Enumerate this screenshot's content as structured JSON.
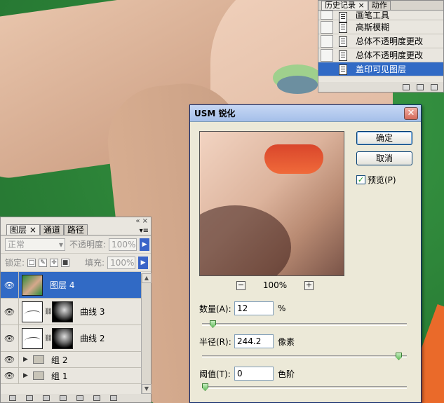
{
  "history": {
    "tabs": [
      "历史记录 ×",
      "动作"
    ],
    "items": [
      "画笔工具",
      "高斯模糊",
      "总体不透明度更改",
      "总体不透明度更改",
      "盖印可见图层"
    ],
    "selected_index": 4
  },
  "dialog": {
    "title": "USM 锐化",
    "close": "✕",
    "ok_label": "确定",
    "cancel_label": "取消",
    "preview_label": "预览(P)",
    "preview_checked": "✓",
    "zoom_out": "−",
    "zoom_in": "+",
    "zoom_value": "100%",
    "amount": {
      "label": "数量(A):",
      "value": "12",
      "unit": "%",
      "level": 0.04
    },
    "radius": {
      "label": "半径(R):",
      "value": "244.2",
      "unit": "像素",
      "level": 0.98
    },
    "threshold": {
      "label": "阈值(T):",
      "value": "0",
      "unit": "色阶",
      "level": 0.0
    }
  },
  "layers": {
    "close_glyphs": "«  ×",
    "tabs": [
      "图层 ×",
      "通道",
      "路径"
    ],
    "menu": "▾≡",
    "blend_mode": "正常",
    "opacity_label": "不透明度:",
    "opacity_value": "100%",
    "lock_label": "锁定:",
    "fill_label": "填充:",
    "fill_value": "100%",
    "items": [
      {
        "name": "图层 4",
        "type": "image"
      },
      {
        "name": "曲线 3",
        "type": "curves"
      },
      {
        "name": "曲线 2",
        "type": "curves"
      },
      {
        "name": "组 2",
        "type": "group"
      },
      {
        "name": "组 1",
        "type": "group"
      }
    ],
    "eye": "👁"
  },
  "colors": {
    "selection": "#316ac5",
    "background_green": "#2f8a3a",
    "lips": "#f06a3a"
  }
}
